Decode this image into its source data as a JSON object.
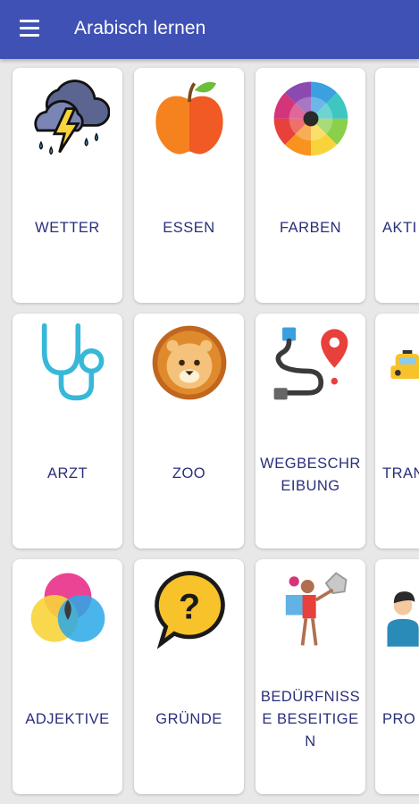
{
  "app": {
    "title": "Arabisch lernen"
  },
  "cards": [
    {
      "label": "WETTER",
      "icon": "thunderstorm-cloud-icon"
    },
    {
      "label": "ESSEN",
      "icon": "apple-icon"
    },
    {
      "label": "FARBEN",
      "icon": "color-wheel-icon"
    },
    {
      "label": "AKTI",
      "icon": ""
    },
    {
      "label": "ARZT",
      "icon": "stethoscope-icon"
    },
    {
      "label": "ZOO",
      "icon": "lion-icon"
    },
    {
      "label": "WEGBESCHREIBUNG",
      "icon": "route-pin-icon"
    },
    {
      "label": "TRAN",
      "icon": "taxi-icon"
    },
    {
      "label": "ADJEKTIVE",
      "icon": "color-circles-icon"
    },
    {
      "label": "GRÜNDE",
      "icon": "question-bubble-icon"
    },
    {
      "label": "BEDÜRFNISSE BESEITIGEN",
      "icon": "person-juggling-icon"
    },
    {
      "label": "PRO",
      "icon": "person-avatar-icon"
    }
  ]
}
